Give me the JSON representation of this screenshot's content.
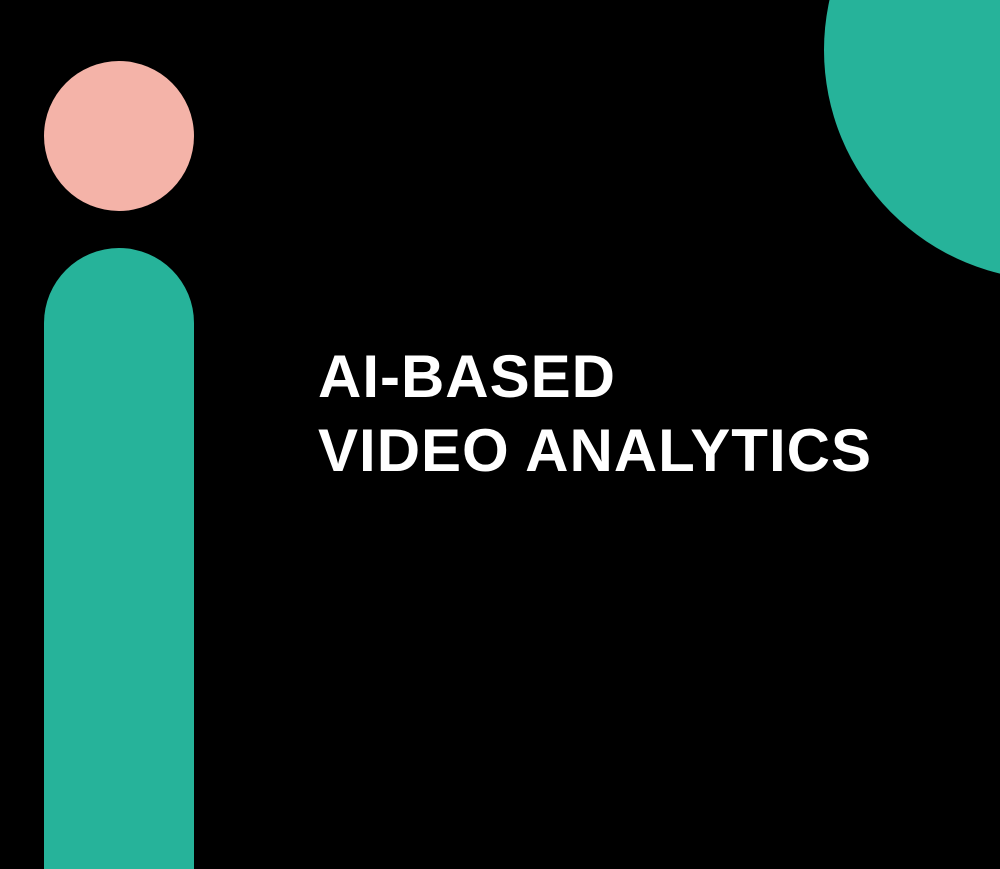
{
  "headline": {
    "line1": "AI-BASED",
    "line2": "VIDEO ANALYTICS"
  },
  "colors": {
    "background": "#000000",
    "accent_teal": "#26b39a",
    "accent_pink": "#f4b3a8",
    "text": "#ffffff"
  }
}
